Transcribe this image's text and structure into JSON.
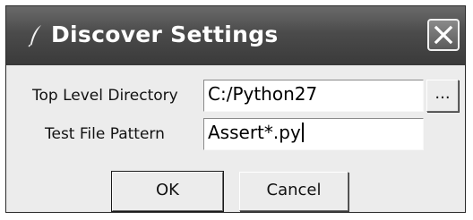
{
  "window": {
    "title": "Discover Settings",
    "close_icon": "close-icon",
    "app_icon": "feather-icon"
  },
  "form": {
    "top_level_directory": {
      "label": "Top Level Directory",
      "value": "C:/Python27",
      "browse_label": "..."
    },
    "test_file_pattern": {
      "label": "Test File Pattern",
      "value": "Assert*.py"
    }
  },
  "buttons": {
    "ok": "OK",
    "cancel": "Cancel"
  },
  "colors": {
    "titlebar": "#4b4b4b",
    "dialog_bg": "#ececec",
    "field_bg": "#ffffff"
  }
}
